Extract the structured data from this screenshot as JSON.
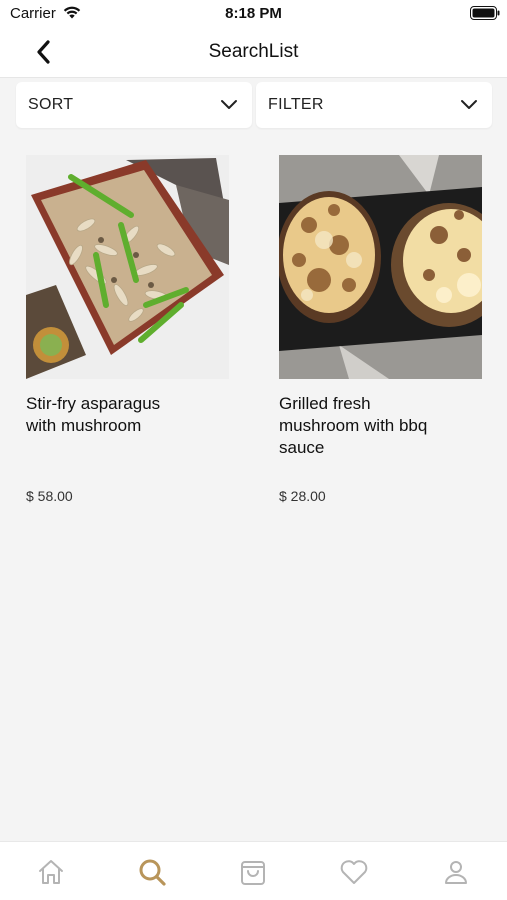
{
  "status_bar": {
    "carrier": "Carrier",
    "time": "8:18 PM"
  },
  "nav": {
    "title": "SearchList"
  },
  "controls": {
    "sort_label": "SORT",
    "filter_label": "FILTER"
  },
  "products": [
    {
      "name": "Stir-fry asparagus with mushroom",
      "price": "$ 58.00"
    },
    {
      "name": "Grilled fresh mushroom with bbq sauce",
      "price": "$ 28.00"
    }
  ],
  "tab_bar": {
    "items": [
      {
        "icon": "home-icon",
        "active": false
      },
      {
        "icon": "search-icon",
        "active": true
      },
      {
        "icon": "shopping-bag-icon",
        "active": false
      },
      {
        "icon": "heart-icon",
        "active": false
      },
      {
        "icon": "user-icon",
        "active": false
      }
    ]
  },
  "colors": {
    "accent": "#b8955a",
    "inactive_icon": "#b4b4b4",
    "background": "#f4f4f4"
  }
}
